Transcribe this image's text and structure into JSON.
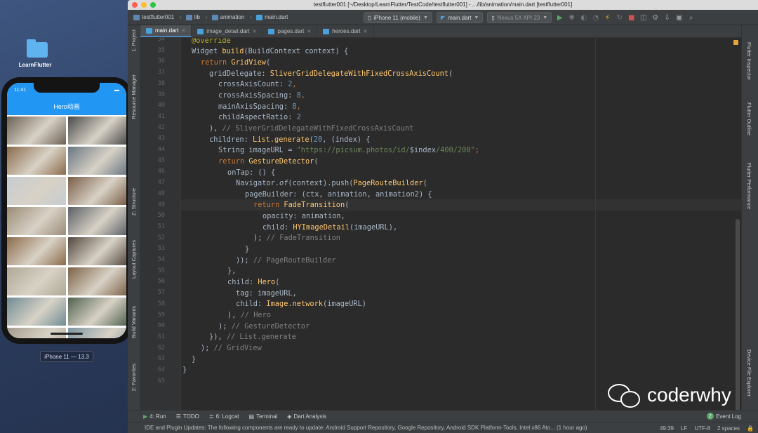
{
  "desktop": {
    "folder_label": "LearnFlutter",
    "device_caption": "iPhone 11 — 13.3"
  },
  "simulator": {
    "time": "11:41",
    "app_title": "Hero动画",
    "tiles": [
      "#6d6154",
      "#4a4a4a",
      "#8b6a4b",
      "#6a7682",
      "#c7ccd1",
      "#7a5d46",
      "#9a8b76",
      "#5b6066",
      "#8c6a4a",
      "#54483f",
      "#aea895",
      "#7c6247",
      "#6f8c93",
      "#51624f",
      "#a59c8e",
      "#7c95a1"
    ]
  },
  "ide": {
    "window_title": "testflutter001 [~/Desktop/LearnFlutter/TestCode/testflutter001] - .../lib/animation/main.dart [testflutter001]",
    "breadcrumbs": [
      "testflutter001",
      "lib",
      "animation",
      "main.dart"
    ],
    "device_select": "iPhone 11 (mobile)",
    "config_select": "main.dart",
    "emulator_select": "Nexus 5X API 23",
    "tabs": [
      "main.dart",
      "image_detail.dart",
      "pages.dart",
      "heroes.dart"
    ],
    "left_tools": [
      "1: Project",
      "Resource Manager",
      "Z: Structure",
      "Layout Captures",
      "Build Variants",
      "2: Favorites"
    ],
    "right_tools": [
      "Flutter Inspector",
      "Flutter Outline",
      "Flutter Performance",
      "Device File Explorer"
    ],
    "line_numbers": [
      "34",
      "35",
      "36",
      "37",
      "38",
      "39",
      "40",
      "41",
      "42",
      "43",
      "44",
      "45",
      "46",
      "47",
      "48",
      "49",
      "50",
      "51",
      "52",
      "53",
      "54",
      "55",
      "56",
      "57",
      "58",
      "59",
      "60",
      "61",
      "62",
      "63",
      "64",
      "65"
    ],
    "code": {
      "l34": "@override",
      "l35a": "Widget ",
      "l35b": "build",
      "l35c": "(BuildContext context) {",
      "l36a": "return ",
      "l36b": "GridView",
      "l36c": "(",
      "l37a": "gridDelegate: ",
      "l37b": "SliverGridDelegateWithFixedCrossAxisCount",
      "l37c": "(",
      "l38a": "crossAxisCount: ",
      "l38b": "2",
      "l38c": ",",
      "l39a": "crossAxisSpacing: ",
      "l39b": "8",
      "l39c": ",",
      "l40a": "mainAxisSpacing: ",
      "l40b": "8",
      "l40c": ",",
      "l41a": "childAspectRatio: ",
      "l41b": "2",
      "l42a": "), ",
      "l42b": "// SliverGridDelegateWithFixedCrossAxisCount",
      "l43a": "children: ",
      "l43b": "List.generate",
      "l43c": "(",
      "l43d": "20",
      "l43e": ", (index) {",
      "l44a": "String imageURL = ",
      "l44b": "\"https://picsum.photos/id/",
      "l44c": "$index",
      "l44d": "/400/200\"",
      "l44e": ";",
      "l45a": "return ",
      "l45b": "GestureDetector",
      "l45c": "(",
      "l46": "onTap: () {",
      "l47a": "Navigator.",
      "l47b": "of",
      "l47c": "(context).push(",
      "l47d": "PageRouteBuilder",
      "l47e": "(",
      "l48": "pageBuilder: (ctx, animation, animation2) {",
      "l49a": "return ",
      "l49b": "FadeTransition",
      "l49c": "(",
      "l50": "opacity: animation,",
      "l51a": "child: ",
      "l51b": "HYImageDetail",
      "l51c": "(imageURL),",
      "l52a": "); ",
      "l52b": "// FadeTransition",
      "l53": "}",
      "l54a": ")); ",
      "l54b": "// PageRouteBuilder",
      "l55": "},",
      "l56a": "child: ",
      "l56b": "Hero",
      "l56c": "(",
      "l57": "tag: imageURL,",
      "l58a": "child: ",
      "l58b": "Image.network",
      "l58c": "(imageURL)",
      "l59a": "), ",
      "l59b": "// Hero",
      "l60a": "); ",
      "l60b": "// GestureDetector",
      "l61a": "}), ",
      "l61b": "// List.generate",
      "l62a": "); ",
      "l62b": "// GridView",
      "l63": "}",
      "l64": "}"
    },
    "bottom_tools": [
      "4: Run",
      "TODO",
      "6: Logcat",
      "Terminal",
      "Dart Analysis"
    ],
    "event_log": "Event Log",
    "event_count": "2",
    "status_message": "IDE and Plugin Updates: The following components are ready to update: Android Support Repository, Google Repository, Android SDK Platform-Tools, Intel x86 Ato... (1 hour ago)",
    "status_right": [
      "49:39",
      "LF",
      "UTF-8",
      "2 spaces"
    ]
  },
  "watermark": "coderwhy",
  "colors": {
    "accent": "#2196f3",
    "keyword": "#cc7832",
    "function": "#ffc66d",
    "string": "#6a8759",
    "number": "#6897bb",
    "comment": "#808080"
  }
}
